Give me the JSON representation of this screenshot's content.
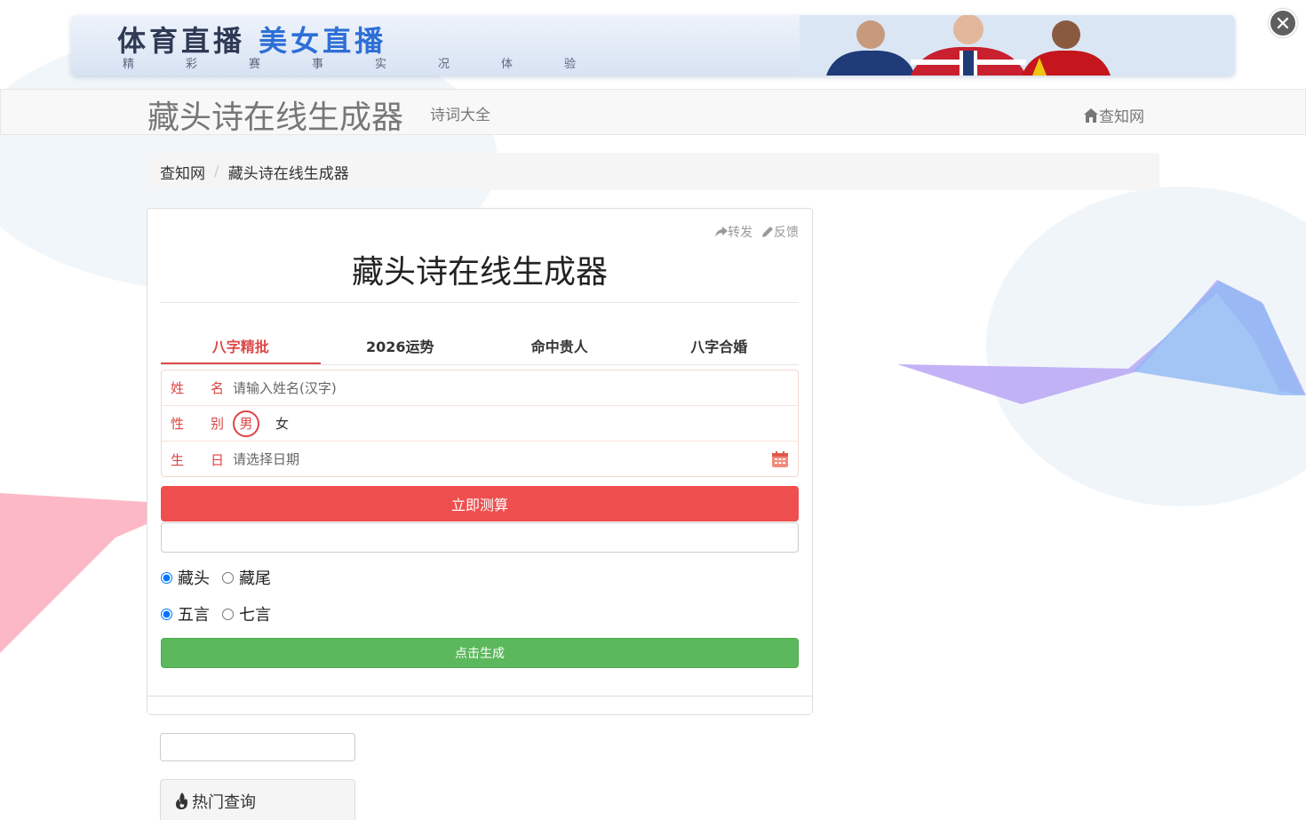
{
  "banner": {
    "title_part1": "体育直播",
    "title_part2": "美女直播",
    "title_part3": "直播",
    "subtitle": "精彩赛事实况体验"
  },
  "close_symbol": "✕",
  "navbar": {
    "brand": "藏头诗在线生成器",
    "link": "诗词大全",
    "home": "查知网"
  },
  "breadcrumb": {
    "home": "查知网",
    "separator": "/",
    "current": "藏头诗在线生成器"
  },
  "panel": {
    "share": "转发",
    "feedback": "反馈",
    "title": "藏头诗在线生成器"
  },
  "tabs": [
    {
      "label": "八字精批",
      "active": true
    },
    {
      "label": "2026运势",
      "active": false
    },
    {
      "label": "命中贵人",
      "active": false
    },
    {
      "label": "八字合婚",
      "active": false
    }
  ],
  "form": {
    "name_label_1": "姓",
    "name_label_2": "名",
    "name_placeholder": "请输入姓名(汉字)",
    "gender_label_1": "性",
    "gender_label_2": "别",
    "male": "男",
    "female": "女",
    "birth_label_1": "生",
    "birth_label_2": "日",
    "birth_placeholder": "请选择日期",
    "submit": "立即测算"
  },
  "options": {
    "position": {
      "head": "藏头",
      "tail": "藏尾",
      "selected": "藏头"
    },
    "length": {
      "five": "五言",
      "seven": "七言",
      "selected": "五言"
    }
  },
  "generate_button": "点击生成",
  "hot": {
    "label": "热门查询"
  },
  "colors": {
    "accent_red": "#ef4f4f",
    "green": "#5cb85c",
    "tab_active": "#e04848"
  }
}
